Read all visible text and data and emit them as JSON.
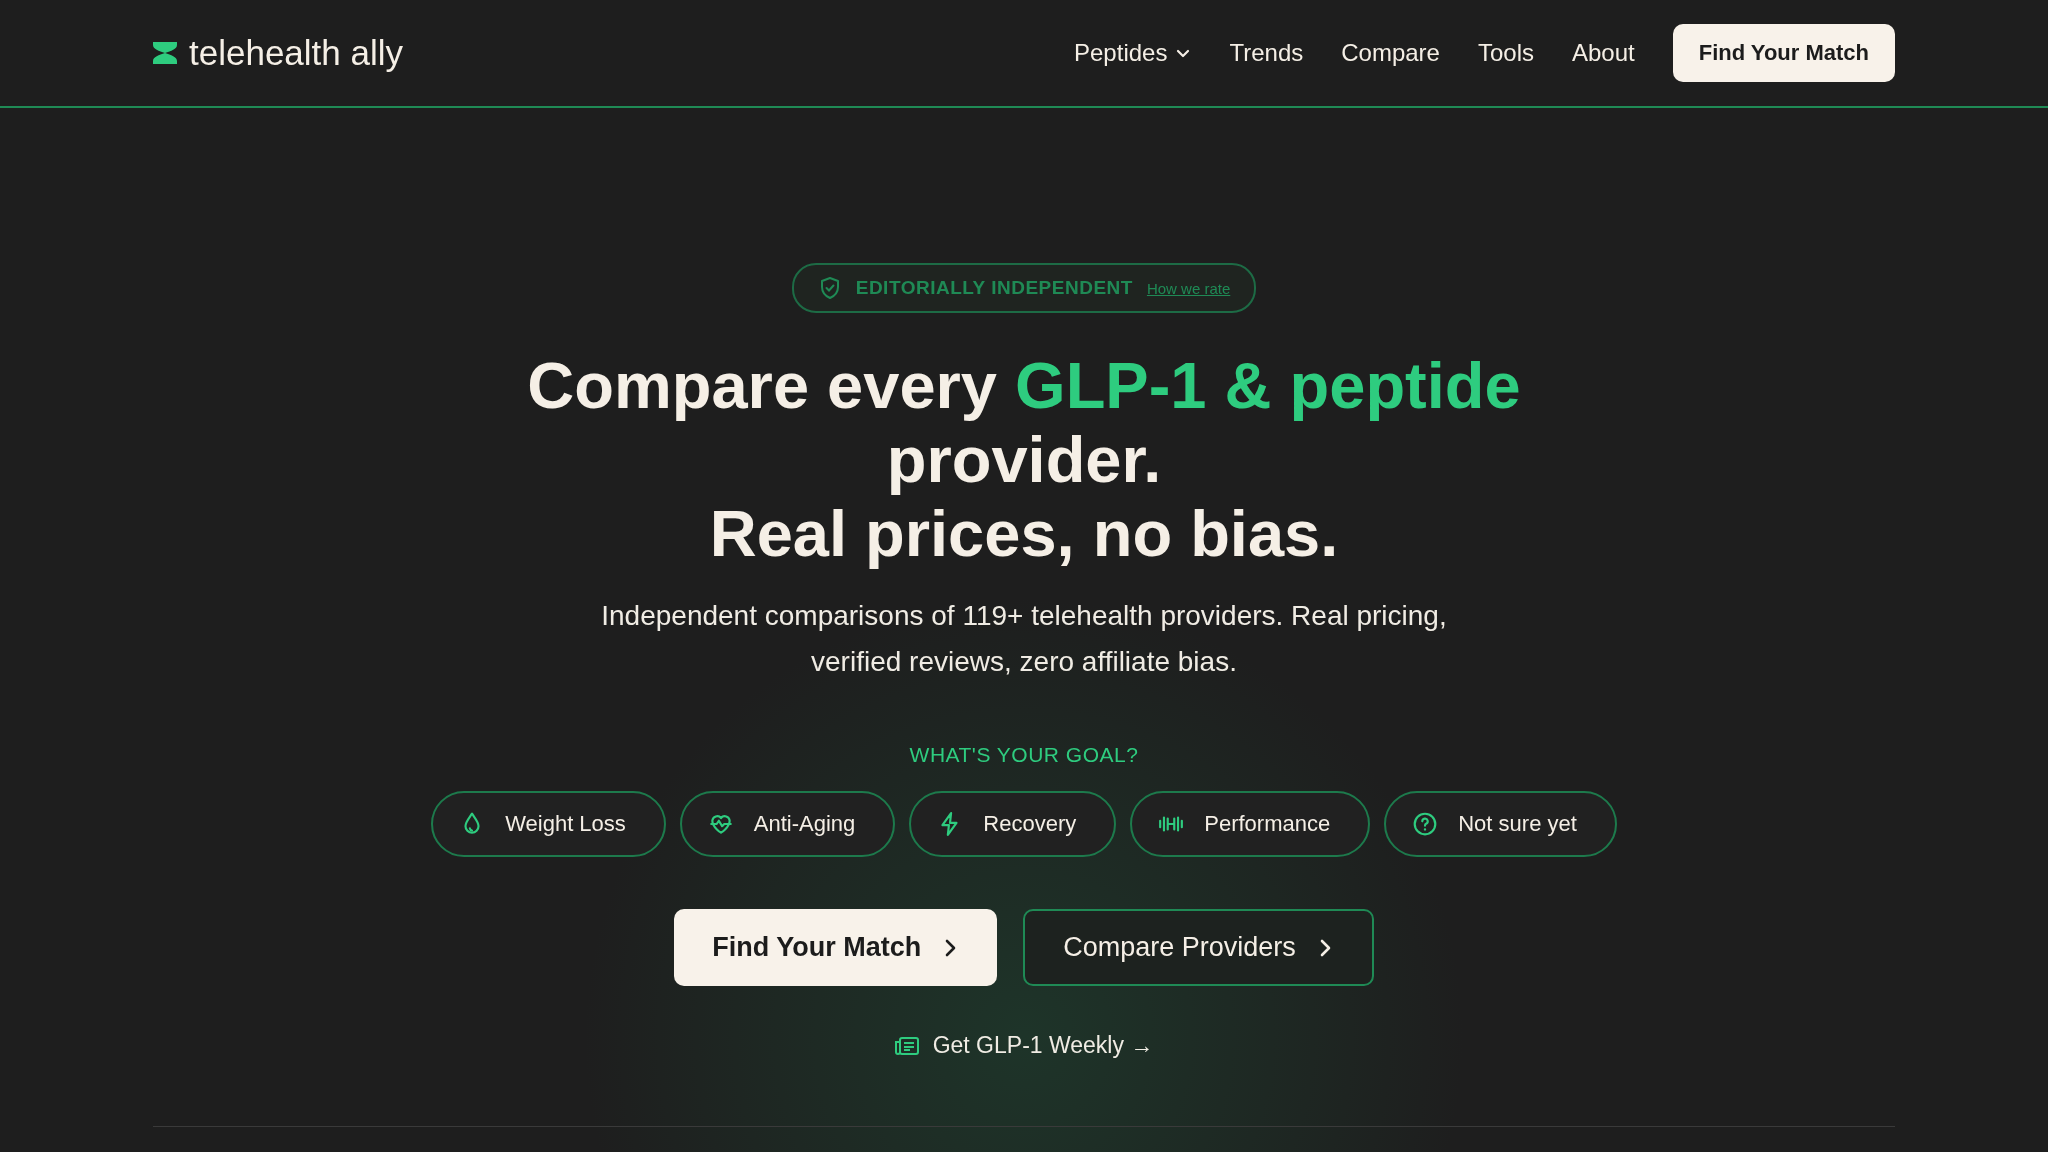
{
  "header": {
    "logo": "telehealth ally",
    "nav": [
      {
        "label": "Peptides",
        "has_menu": true
      },
      {
        "label": "Trends",
        "has_menu": false
      },
      {
        "label": "Compare",
        "has_menu": false
      },
      {
        "label": "Tools",
        "has_menu": false
      },
      {
        "label": "About",
        "has_menu": false
      }
    ],
    "cta": "Find Your Match"
  },
  "hero": {
    "badge": {
      "label": "EDITORIALLY INDEPENDENT",
      "link": "How we rate"
    },
    "title_lines": [
      [
        {
          "text": "Compare every ",
          "accent": false
        },
        {
          "text": "GLP-1 & peptide",
          "accent": true
        },
        {
          "text": " provider.",
          "accent": false
        }
      ],
      [
        {
          "text": "Real prices, no bias.",
          "accent": false
        }
      ]
    ],
    "subtitle": "Independent comparisons of 119+ telehealth providers. Real pricing, verified reviews, zero affiliate bias.",
    "goal_label": "WHAT'S YOUR GOAL?",
    "goals": [
      {
        "label": "Weight Loss",
        "kind": "drop"
      },
      {
        "label": "Anti-Aging",
        "kind": "heart"
      },
      {
        "label": "Recovery",
        "kind": "bolt"
      },
      {
        "label": "Performance",
        "kind": "dumbbell"
      },
      {
        "label": "Not sure yet",
        "kind": "question"
      }
    ],
    "buttons": [
      {
        "label": "Find Your Match",
        "kind": "primary"
      },
      {
        "label": "Compare Providers",
        "kind": "secondary"
      }
    ],
    "newsletter": "Get GLP-1 Weekly →"
  }
}
